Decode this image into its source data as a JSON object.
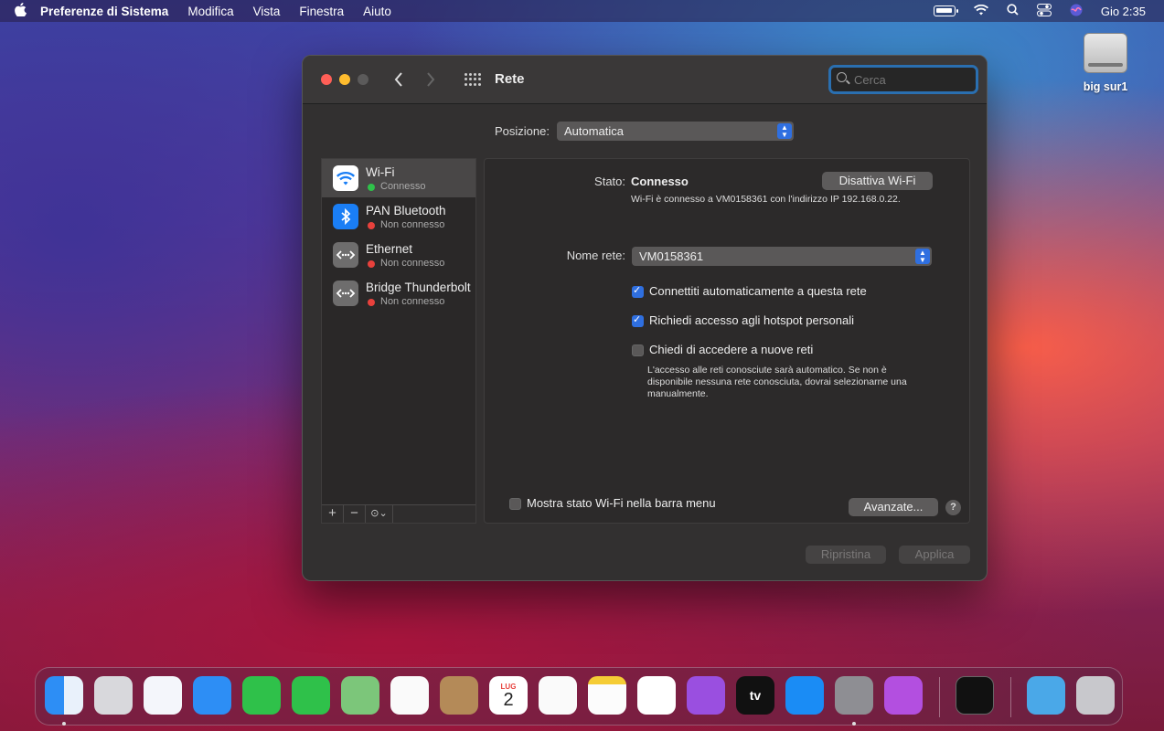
{
  "menubar": {
    "apple": "",
    "app_name": "Preferenze di Sistema",
    "items": [
      "Modifica",
      "Vista",
      "Finestra",
      "Aiuto"
    ],
    "clock": "Gio 2:35"
  },
  "desktop": {
    "disk_label": "big sur1"
  },
  "window": {
    "title": "Rete",
    "search_placeholder": "Cerca",
    "location_label": "Posizione:",
    "location_value": "Automatica",
    "services": [
      {
        "name": "Wi-Fi",
        "status": "Connesso",
        "status_color": "#2fc14a",
        "icon": "wifi-icon"
      },
      {
        "name": "PAN Bluetooth",
        "status": "Non connesso",
        "status_color": "#e8413c",
        "icon": "bluetooth-icon"
      },
      {
        "name": "Ethernet",
        "status": "Non connesso",
        "status_color": "#e8413c",
        "icon": "ethernet-icon"
      },
      {
        "name": "Bridge Thunderbolt",
        "status": "Non connesso",
        "status_color": "#e8413c",
        "icon": "ethernet-icon"
      }
    ],
    "sidebar_buttons": {
      "add": "+",
      "remove": "−",
      "action": "⊙⌄"
    },
    "detail": {
      "status_label": "Stato:",
      "status_value": "Connesso",
      "toggle_button": "Disattiva Wi-Fi",
      "status_description": "Wi-Fi è connesso a VM0158361 con l'indirizzo IP 192.168.0.22.",
      "network_label": "Nome rete:",
      "network_value": "VM0158361",
      "checkbox_auto_join": {
        "label": "Connettiti automaticamente a questa rete",
        "checked": true
      },
      "checkbox_hotspot": {
        "label": "Richiedi accesso agli hotspot personali",
        "checked": true
      },
      "checkbox_ask_new": {
        "label": "Chiedi di accedere a nuove reti",
        "checked": false
      },
      "ask_new_note": "L'accesso alle reti conosciute sarà automatico. Se non è disponibile nessuna rete conosciuta, dovrai selezionarne una manualmente.",
      "menu_bar_checkbox": {
        "label": "Mostra stato Wi-Fi nella barra menu",
        "checked": false
      },
      "advanced_button": "Avanzate...",
      "help_button": "?"
    },
    "revert_button": "Ripristina",
    "apply_button": "Applica"
  },
  "dock": {
    "calendar_month": "LUG",
    "calendar_day": "2",
    "tv_label": "tv"
  }
}
